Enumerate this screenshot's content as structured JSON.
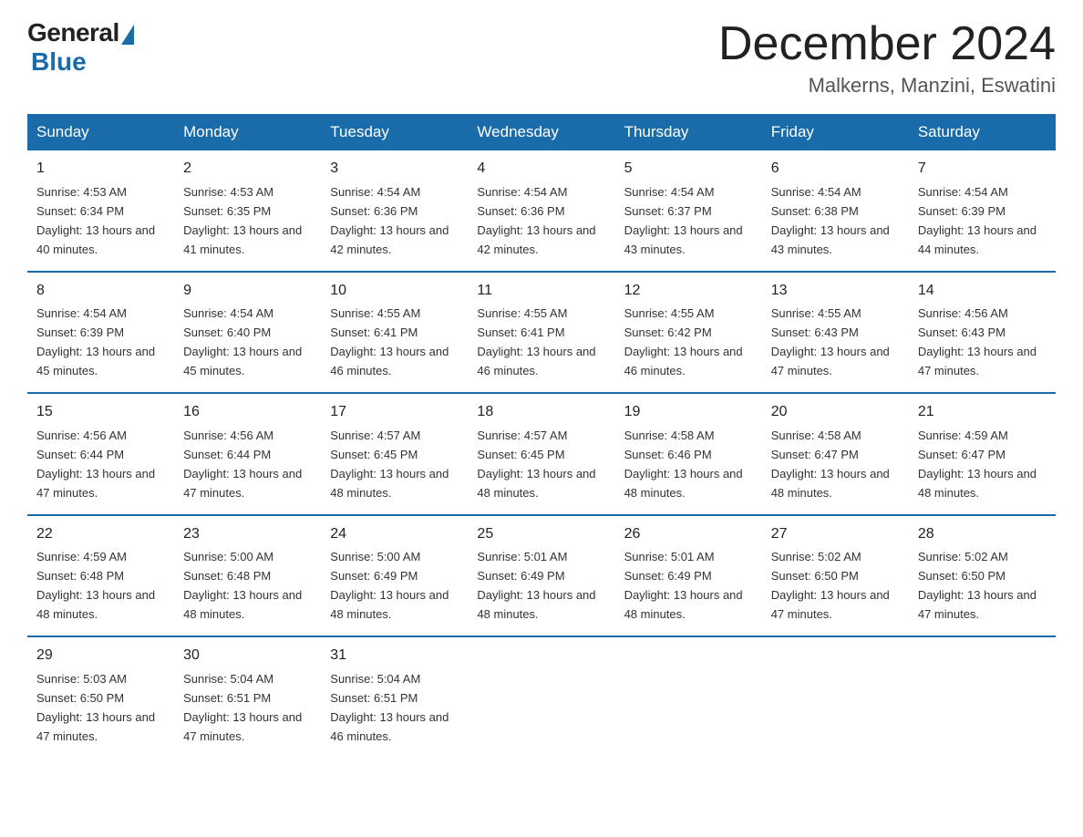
{
  "header": {
    "logo_general": "General",
    "logo_blue": "Blue",
    "month_title": "December 2024",
    "location": "Malkerns, Manzini, Eswatini"
  },
  "days_of_week": [
    "Sunday",
    "Monday",
    "Tuesday",
    "Wednesday",
    "Thursday",
    "Friday",
    "Saturday"
  ],
  "weeks": [
    [
      {
        "day": "1",
        "sunrise": "4:53 AM",
        "sunset": "6:34 PM",
        "daylight": "13 hours and 40 minutes."
      },
      {
        "day": "2",
        "sunrise": "4:53 AM",
        "sunset": "6:35 PM",
        "daylight": "13 hours and 41 minutes."
      },
      {
        "day": "3",
        "sunrise": "4:54 AM",
        "sunset": "6:36 PM",
        "daylight": "13 hours and 42 minutes."
      },
      {
        "day": "4",
        "sunrise": "4:54 AM",
        "sunset": "6:36 PM",
        "daylight": "13 hours and 42 minutes."
      },
      {
        "day": "5",
        "sunrise": "4:54 AM",
        "sunset": "6:37 PM",
        "daylight": "13 hours and 43 minutes."
      },
      {
        "day": "6",
        "sunrise": "4:54 AM",
        "sunset": "6:38 PM",
        "daylight": "13 hours and 43 minutes."
      },
      {
        "day": "7",
        "sunrise": "4:54 AM",
        "sunset": "6:39 PM",
        "daylight": "13 hours and 44 minutes."
      }
    ],
    [
      {
        "day": "8",
        "sunrise": "4:54 AM",
        "sunset": "6:39 PM",
        "daylight": "13 hours and 45 minutes."
      },
      {
        "day": "9",
        "sunrise": "4:54 AM",
        "sunset": "6:40 PM",
        "daylight": "13 hours and 45 minutes."
      },
      {
        "day": "10",
        "sunrise": "4:55 AM",
        "sunset": "6:41 PM",
        "daylight": "13 hours and 46 minutes."
      },
      {
        "day": "11",
        "sunrise": "4:55 AM",
        "sunset": "6:41 PM",
        "daylight": "13 hours and 46 minutes."
      },
      {
        "day": "12",
        "sunrise": "4:55 AM",
        "sunset": "6:42 PM",
        "daylight": "13 hours and 46 minutes."
      },
      {
        "day": "13",
        "sunrise": "4:55 AM",
        "sunset": "6:43 PM",
        "daylight": "13 hours and 47 minutes."
      },
      {
        "day": "14",
        "sunrise": "4:56 AM",
        "sunset": "6:43 PM",
        "daylight": "13 hours and 47 minutes."
      }
    ],
    [
      {
        "day": "15",
        "sunrise": "4:56 AM",
        "sunset": "6:44 PM",
        "daylight": "13 hours and 47 minutes."
      },
      {
        "day": "16",
        "sunrise": "4:56 AM",
        "sunset": "6:44 PM",
        "daylight": "13 hours and 47 minutes."
      },
      {
        "day": "17",
        "sunrise": "4:57 AM",
        "sunset": "6:45 PM",
        "daylight": "13 hours and 48 minutes."
      },
      {
        "day": "18",
        "sunrise": "4:57 AM",
        "sunset": "6:45 PM",
        "daylight": "13 hours and 48 minutes."
      },
      {
        "day": "19",
        "sunrise": "4:58 AM",
        "sunset": "6:46 PM",
        "daylight": "13 hours and 48 minutes."
      },
      {
        "day": "20",
        "sunrise": "4:58 AM",
        "sunset": "6:47 PM",
        "daylight": "13 hours and 48 minutes."
      },
      {
        "day": "21",
        "sunrise": "4:59 AM",
        "sunset": "6:47 PM",
        "daylight": "13 hours and 48 minutes."
      }
    ],
    [
      {
        "day": "22",
        "sunrise": "4:59 AM",
        "sunset": "6:48 PM",
        "daylight": "13 hours and 48 minutes."
      },
      {
        "day": "23",
        "sunrise": "5:00 AM",
        "sunset": "6:48 PM",
        "daylight": "13 hours and 48 minutes."
      },
      {
        "day": "24",
        "sunrise": "5:00 AM",
        "sunset": "6:49 PM",
        "daylight": "13 hours and 48 minutes."
      },
      {
        "day": "25",
        "sunrise": "5:01 AM",
        "sunset": "6:49 PM",
        "daylight": "13 hours and 48 minutes."
      },
      {
        "day": "26",
        "sunrise": "5:01 AM",
        "sunset": "6:49 PM",
        "daylight": "13 hours and 48 minutes."
      },
      {
        "day": "27",
        "sunrise": "5:02 AM",
        "sunset": "6:50 PM",
        "daylight": "13 hours and 47 minutes."
      },
      {
        "day": "28",
        "sunrise": "5:02 AM",
        "sunset": "6:50 PM",
        "daylight": "13 hours and 47 minutes."
      }
    ],
    [
      {
        "day": "29",
        "sunrise": "5:03 AM",
        "sunset": "6:50 PM",
        "daylight": "13 hours and 47 minutes."
      },
      {
        "day": "30",
        "sunrise": "5:04 AM",
        "sunset": "6:51 PM",
        "daylight": "13 hours and 47 minutes."
      },
      {
        "day": "31",
        "sunrise": "5:04 AM",
        "sunset": "6:51 PM",
        "daylight": "13 hours and 46 minutes."
      },
      null,
      null,
      null,
      null
    ]
  ]
}
